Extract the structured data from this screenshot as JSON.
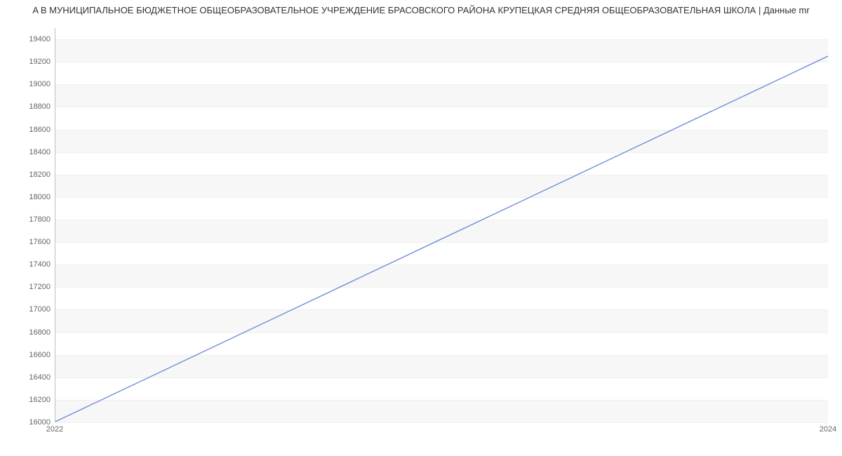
{
  "title": "A В МУНИЦИПАЛЬНОЕ БЮДЖЕТНОЕ ОБЩЕОБРАЗОВАТЕЛЬНОЕ УЧРЕЖДЕНИЕ БРАСОВСКОГО РАЙОНА КРУПЕЦКАЯ СРЕДНЯЯ ОБЩЕОБРАЗОВАТЕЛЬНАЯ ШКОЛА | Данные mr",
  "chart_data": {
    "type": "line",
    "x": [
      2022,
      2024
    ],
    "values": [
      16000,
      19250
    ],
    "xlabel": "",
    "ylabel": "",
    "title": "A В МУНИЦИПАЛЬНОЕ БЮДЖЕТНОЕ ОБЩЕОБРАЗОВАТЕЛЬНОЕ УЧРЕЖДЕНИЕ БРАСОВСКОГО РАЙОНА КРУПЕЦКАЯ СРЕДНЯЯ ОБЩЕОБРАЗОВАТЕЛЬНАЯ ШКОЛА | Данные mr",
    "xlim": [
      2022,
      2024
    ],
    "ylim": [
      16000,
      19500
    ],
    "x_ticks": [
      2022,
      2024
    ],
    "y_ticks": [
      16000,
      16200,
      16400,
      16600,
      16800,
      17000,
      17200,
      17400,
      17600,
      17800,
      18000,
      18200,
      18400,
      18600,
      18800,
      19000,
      19200,
      19400
    ],
    "grid": true
  }
}
